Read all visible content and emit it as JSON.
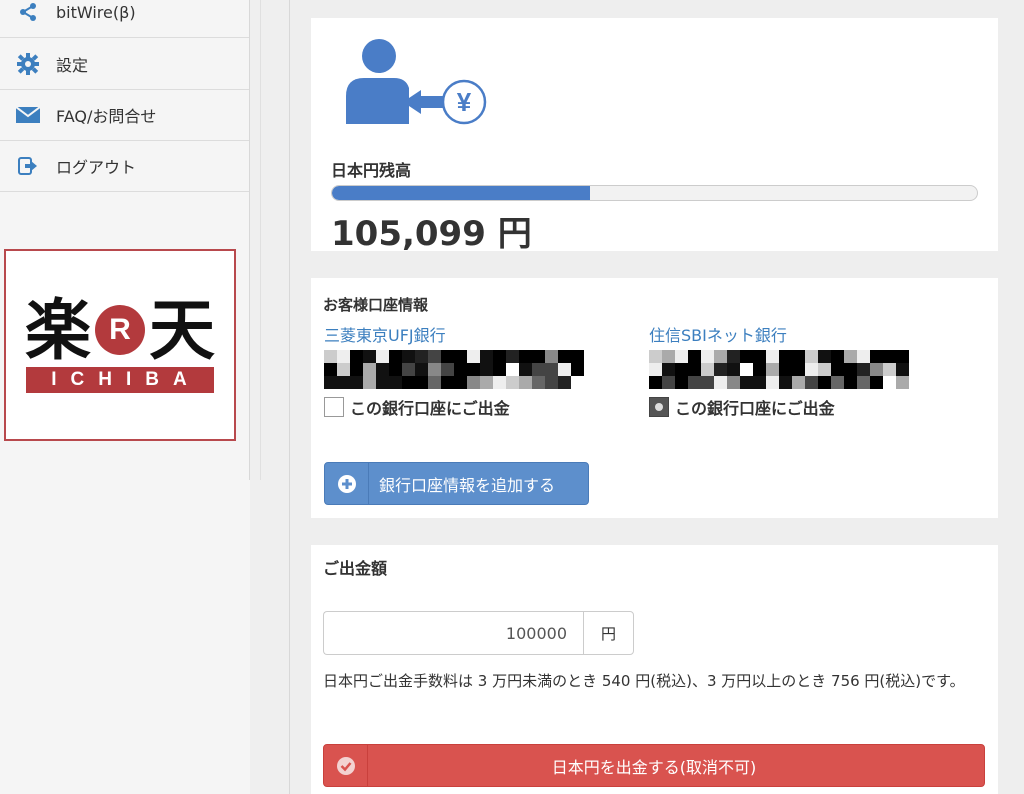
{
  "sidebar": {
    "items": [
      {
        "label": "bitWire(β)",
        "icon": "share-icon"
      },
      {
        "label": "設定",
        "icon": "gear-icon"
      },
      {
        "label": "FAQ/お問合せ",
        "icon": "envelope-icon"
      },
      {
        "label": "ログアウト",
        "icon": "logout-icon"
      }
    ],
    "ad": {
      "brand": "楽天",
      "mark": "R",
      "sub": "ICHIBA"
    }
  },
  "balance": {
    "label": "日本円残高",
    "amount": "105,099 円",
    "progress_fraction": 0.4,
    "icon_symbol": "¥"
  },
  "bank_info": {
    "title": "お客様口座情報",
    "accounts": [
      {
        "bank_name": "三菱東京UFJ銀行",
        "checkbox_label": "この銀行口座にご出金",
        "selected": false
      },
      {
        "bank_name": "住信SBIネット銀行",
        "checkbox_label": "この銀行口座にご出金",
        "selected": true
      }
    ],
    "add_button_label": "銀行口座情報を追加する"
  },
  "withdraw": {
    "title": "ご出金額",
    "amount_value": "100000",
    "unit": "円",
    "fee_note": "日本円ご出金手数料は 3 万円未満のとき 540 円(税込)、3 万円以上のとき 756 円(税込)です。",
    "button_label": "日本円を出金する(取消不可)"
  },
  "colors": {
    "accent_blue": "#4a7dc7",
    "link_blue": "#3c7fbf",
    "danger_red": "#d9534f",
    "brand_red": "#b33a3d"
  }
}
